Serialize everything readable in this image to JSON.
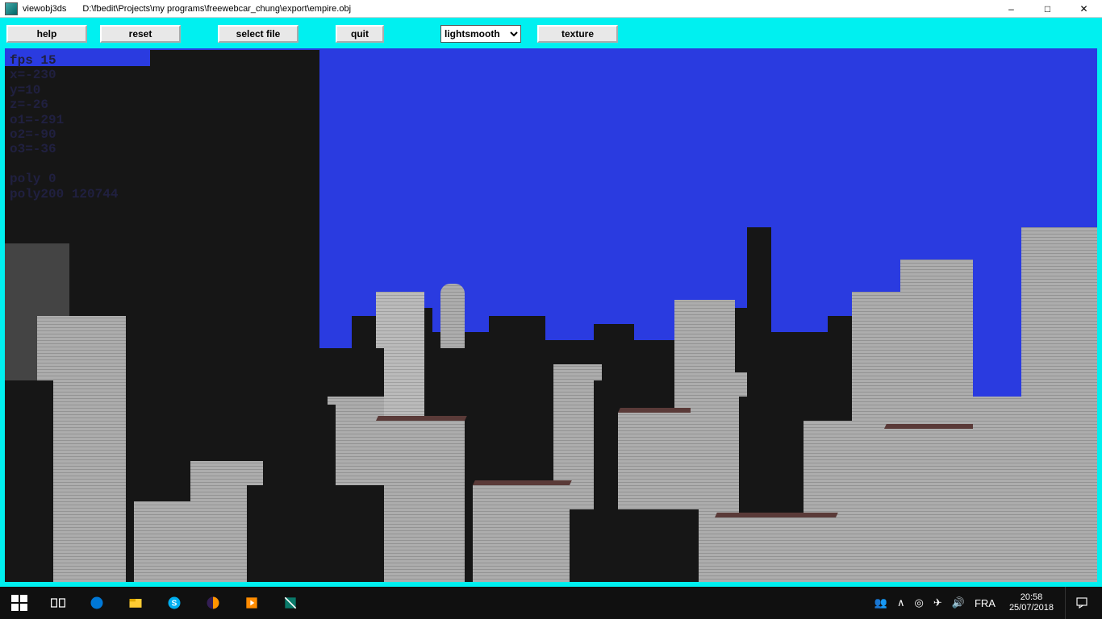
{
  "window": {
    "app_name": "viewobj3ds",
    "file_path": "D:\\fbedit\\Projects\\my programs\\freewebcar_chung\\export\\empire.obj"
  },
  "toolbar": {
    "help": "help",
    "reset": "reset",
    "select_file": "select file",
    "quit": "quit",
    "render_mode": "lightsmooth",
    "texture": "texture"
  },
  "stats": {
    "fps": "fps 15",
    "x": "x=-230",
    "y": "y=10",
    "z": "z=-26",
    "o1": "o1=-291",
    "o2": "o2=-90",
    "o3": "o3=-36",
    "poly": "poly 0",
    "poly2": "poly200 120744"
  },
  "taskbar": {
    "lang": "FRA",
    "time": "20:58",
    "date": "25/07/2018"
  }
}
